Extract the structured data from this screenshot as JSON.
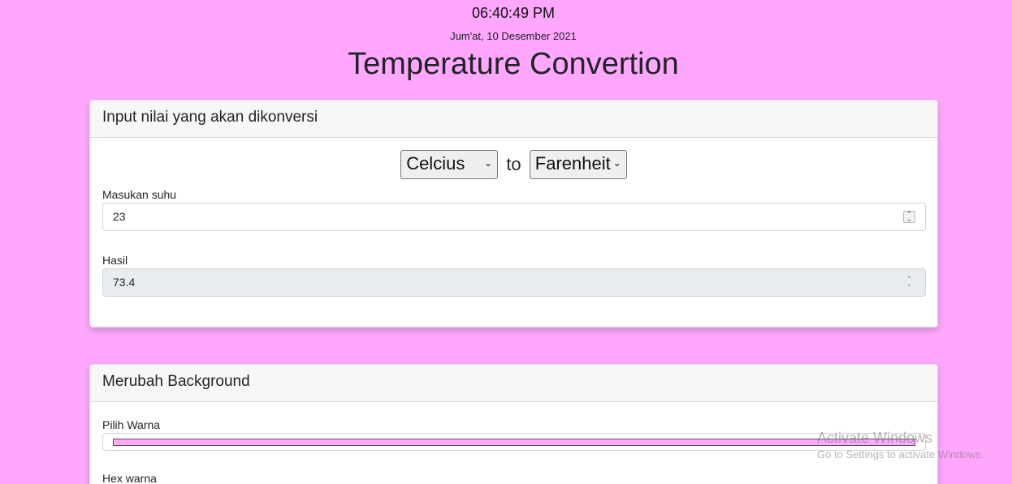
{
  "header": {
    "clock": "06:40:49 PM",
    "date": "Jum'at, 10 Desember 2021",
    "title": "Temperature Convertion"
  },
  "converter_card": {
    "title": "Input nilai yang akan dikonversi",
    "from_unit": "Celcius",
    "to_word": "to",
    "to_unit": "Farenheit",
    "input_label": "Masukan suhu",
    "input_value": "23",
    "result_label": "Hasil",
    "result_value": "73.4"
  },
  "background_card": {
    "title": "Merubah Background",
    "color_label": "Pilih Warna",
    "color_value": "#fea7fd",
    "hex_label": "Hex warna"
  },
  "watermark": {
    "line1": "Activate Windows",
    "line2": "Go to Settings to activate Windows."
  },
  "colors": {
    "page_background": "#fea7fd"
  }
}
